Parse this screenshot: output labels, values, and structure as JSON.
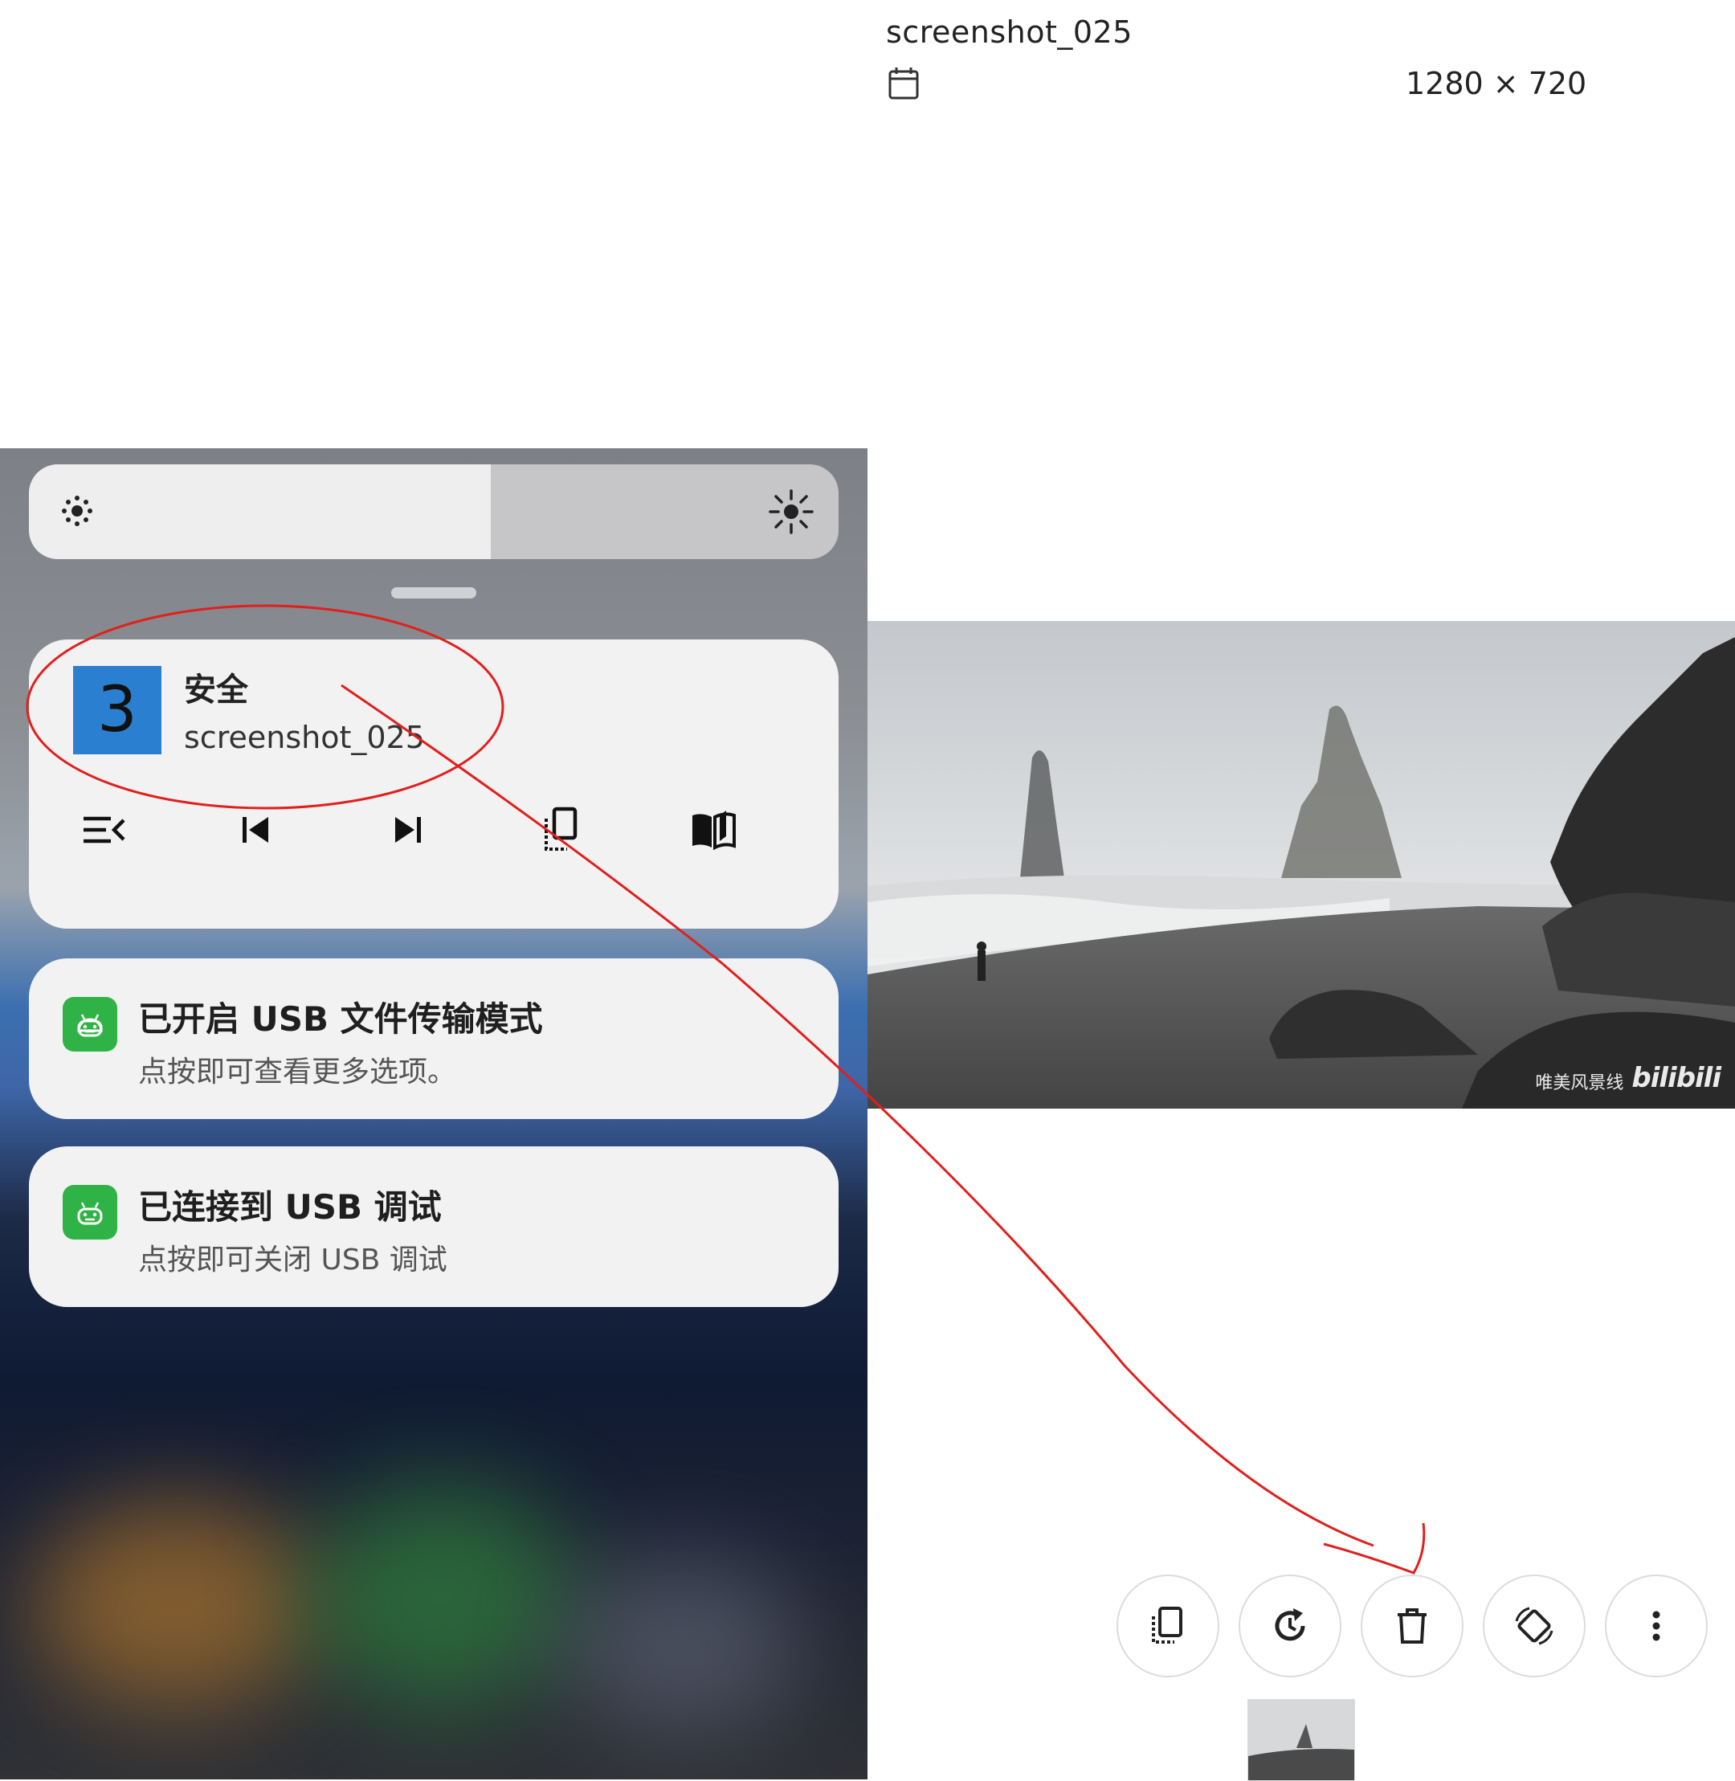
{
  "viewer": {
    "filename": "screenshot_025",
    "dimensions": "1280 × 720",
    "calendar_icon": "calendar-icon",
    "watermark_text": "唯美风景线",
    "watermark_logo": "bilibili",
    "toolbar": [
      {
        "name": "copy-button",
        "icon": "copy-icon"
      },
      {
        "name": "rotate-button",
        "icon": "rotate-clock-icon"
      },
      {
        "name": "delete-button",
        "icon": "trash-icon"
      },
      {
        "name": "auto-rotate-button",
        "icon": "screen-rotation-icon"
      },
      {
        "name": "more-button",
        "icon": "more-vert-icon"
      }
    ]
  },
  "shade": {
    "brightness_level": 0.57,
    "media": {
      "app_tile_text": "3",
      "title": "安全",
      "subtitle": "screenshot_025",
      "controls": [
        "playlist-icon",
        "previous-icon",
        "next-icon",
        "copy-icon",
        "book-icon"
      ]
    },
    "notifications": [
      {
        "title": "已开启 USB 文件传输模式",
        "subtitle": "点按即可查看更多选项。",
        "icon": "android-icon"
      },
      {
        "title": "已连接到 USB 调试",
        "subtitle": "点按即可关闭 USB 调试",
        "icon": "android-icon"
      }
    ]
  },
  "colors": {
    "annotation": "#e0201c",
    "app_tile": "#2b7fd0",
    "usb_icon": "#2fb346"
  }
}
